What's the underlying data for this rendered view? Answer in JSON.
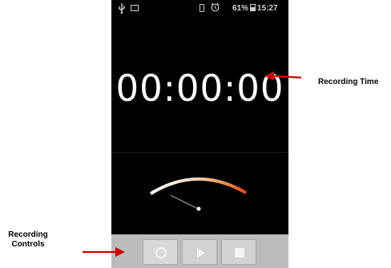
{
  "status_bar": {
    "battery": "61%",
    "clock": "15:27",
    "icons": [
      "usb-icon",
      "image-icon",
      "vibrate-icon",
      "alarm-icon",
      "battery-icon"
    ]
  },
  "recorder": {
    "time": "00:00:00",
    "level": 0
  },
  "controls": {
    "buttons": [
      "record",
      "play",
      "stop"
    ]
  },
  "annotations": {
    "time_label": "Recording Time",
    "controls_label_line1": "Recording",
    "controls_label_line2": "Controls"
  },
  "colors": {
    "screen": "#000000",
    "control_bar": "#bcbcbc",
    "arrow": "#cc0000",
    "meter_low": "#ffffff",
    "meter_high": "#e8481a"
  }
}
